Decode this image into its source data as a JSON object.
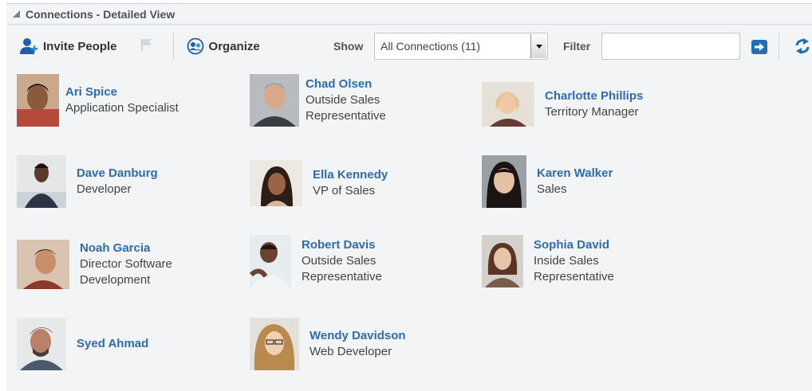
{
  "panel": {
    "title": "Connections - Detailed View"
  },
  "toolbar": {
    "invite_label": "Invite People",
    "organize_label": "Organize",
    "show_label": "Show",
    "show_value": "All Connections (11)",
    "filter_label": "Filter",
    "filter_value": ""
  },
  "colors": {
    "link": "#2e6bb2",
    "accent": "#1f6fb8",
    "panel_bg": "#f3f4f6"
  },
  "people": [
    {
      "name": "Ari Spice",
      "role": "Application Specialist"
    },
    {
      "name": "Chad Olsen",
      "role": "Outside Sales Representative"
    },
    {
      "name": "Charlotte Phillips",
      "role": "Territory Manager"
    },
    {
      "name": "Dave Danburg",
      "role": "Developer"
    },
    {
      "name": "Ella Kennedy",
      "role": "VP of Sales"
    },
    {
      "name": "Karen Walker",
      "role": "Sales"
    },
    {
      "name": "Noah Garcia",
      "role": "Director Software Development"
    },
    {
      "name": "Robert Davis",
      "role": "Outside Sales Representative"
    },
    {
      "name": "Sophia David",
      "role": "Inside Sales Representative"
    },
    {
      "name": "Syed Ahmad",
      "role": ""
    },
    {
      "name": "Wendy Davidson",
      "role": "Web Developer"
    }
  ]
}
